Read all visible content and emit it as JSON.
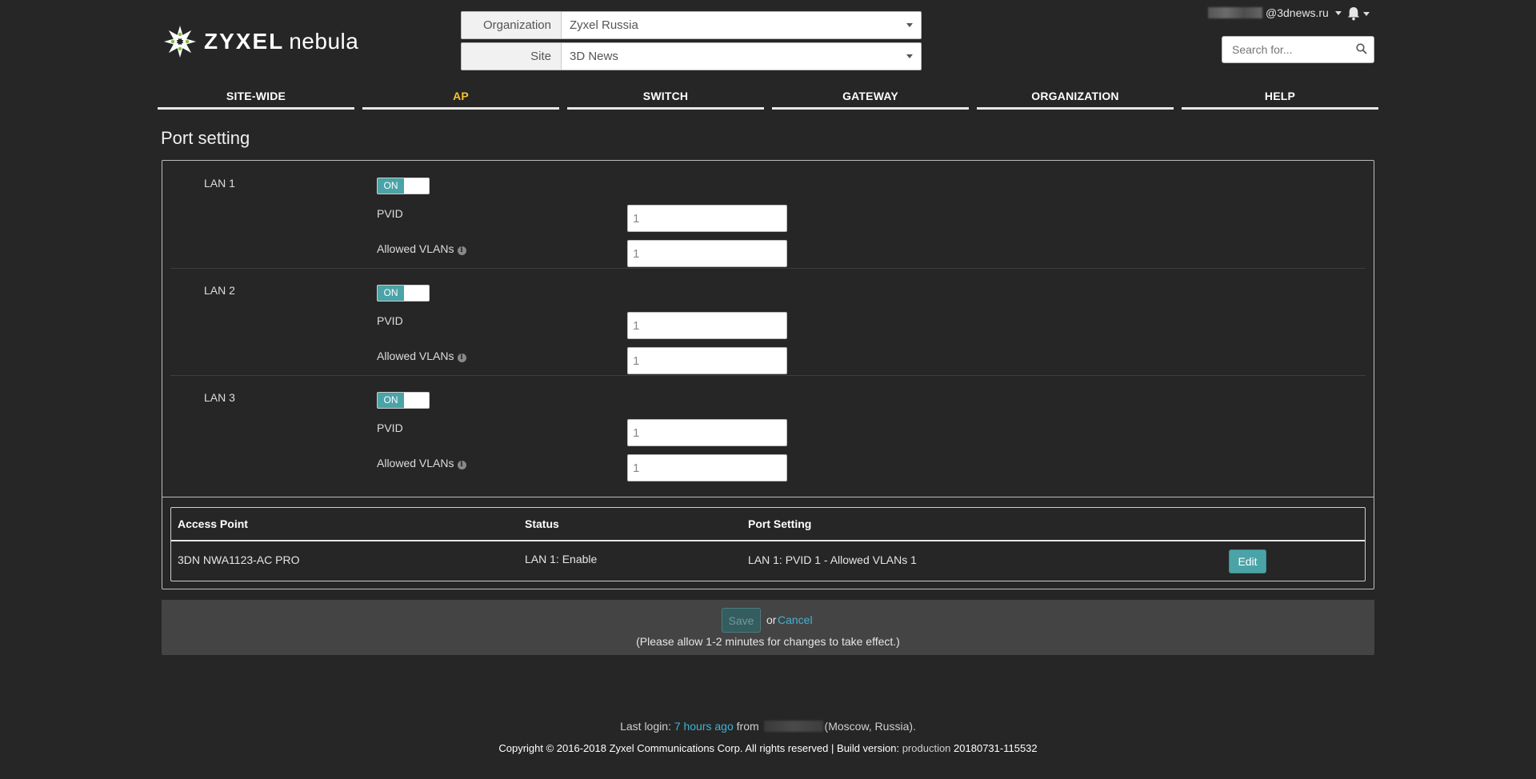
{
  "logo": {
    "brand": "ZYXEL",
    "product": "nebula"
  },
  "selectors": {
    "organization": {
      "label": "Organization",
      "value": "Zyxel Russia"
    },
    "site": {
      "label": "Site",
      "value": "3D News"
    }
  },
  "user": {
    "email_suffix": "@3dnews.ru"
  },
  "search": {
    "placeholder": "Search for..."
  },
  "nav": {
    "items": [
      "SITE-WIDE",
      "AP",
      "SWITCH",
      "GATEWAY",
      "ORGANIZATION",
      "HELP"
    ],
    "active": "AP"
  },
  "page": {
    "title": "Port setting"
  },
  "ports": [
    {
      "name": "LAN 1",
      "toggle": "ON",
      "pvid_label": "PVID",
      "pvid": "1",
      "vlans_label": "Allowed VLANs",
      "vlans": "1"
    },
    {
      "name": "LAN 2",
      "toggle": "ON",
      "pvid_label": "PVID",
      "pvid": "1",
      "vlans_label": "Allowed VLANs",
      "vlans": "1"
    },
    {
      "name": "LAN 3",
      "toggle": "ON",
      "pvid_label": "PVID",
      "pvid": "1",
      "vlans_label": "Allowed VLANs",
      "vlans": "1"
    }
  ],
  "table": {
    "headers": [
      "Access Point",
      "Status",
      "Port Setting"
    ],
    "rows": [
      {
        "access_point": "3DN NWA1123-AC PRO",
        "status": "LAN 1: Enable",
        "port_setting": "LAN 1: PVID 1 - Allowed VLANs 1",
        "action": "Edit"
      }
    ]
  },
  "savebar": {
    "save": "Save",
    "or": "or",
    "cancel": "Cancel",
    "note": "(Please allow 1-2 minutes for changes to take effect.)"
  },
  "footer": {
    "last_login_prefix": "Last login:",
    "last_login_time": "7 hours ago",
    "from": "from",
    "location": "(Moscow, Russia).",
    "copyright": "Copyright © 2016-2018 Zyxel Communications Corp. All rights reserved",
    "separator": "|",
    "build_label": "Build version:",
    "build_env": "production",
    "build_id": "20180731-115532"
  },
  "colors": {
    "accent": "#4aa3a7",
    "active_nav": "#f2c230",
    "link": "#3fb3d4",
    "background": "#262626"
  }
}
